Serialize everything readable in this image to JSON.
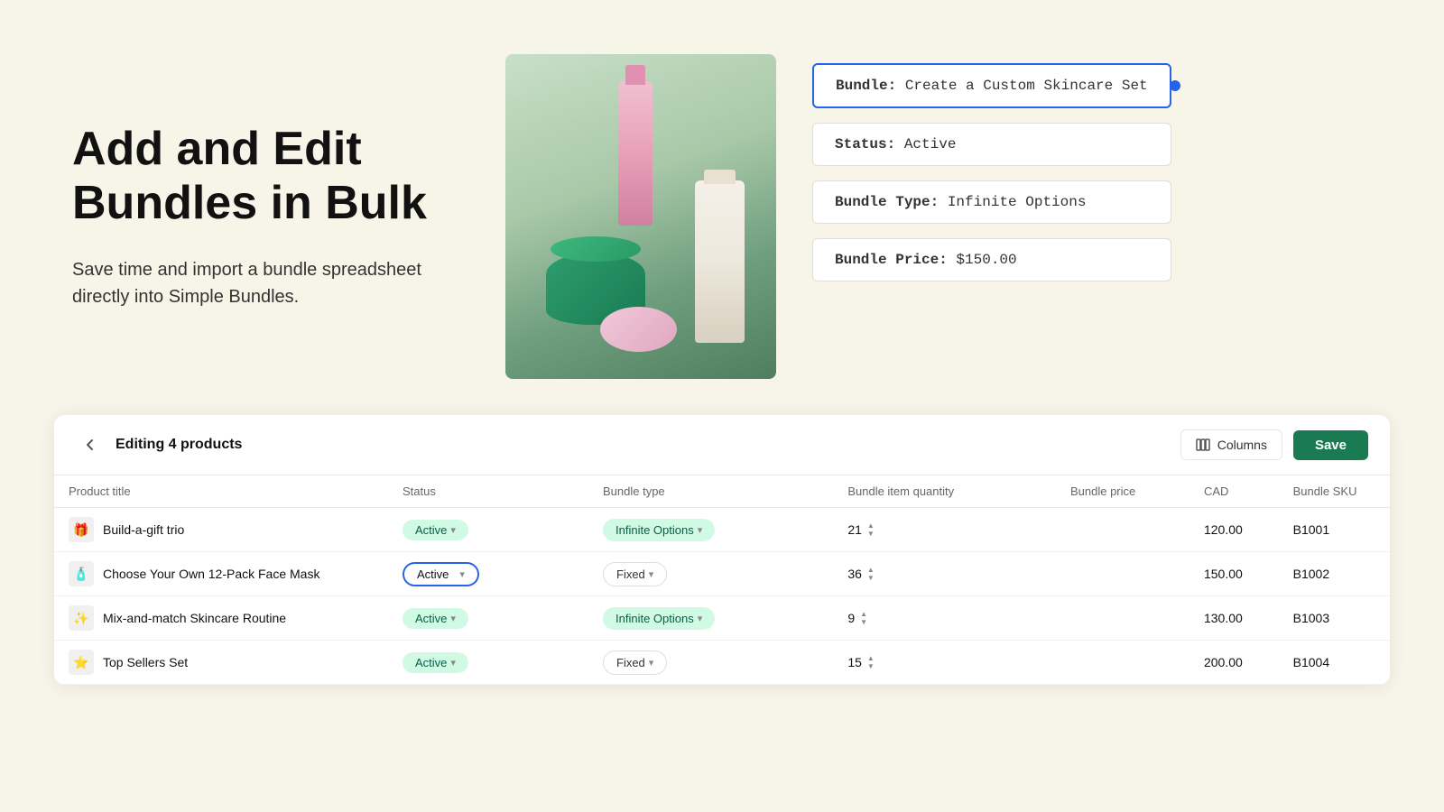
{
  "hero": {
    "title": "Add and Edit Bundles in Bulk",
    "subtitle": "Save time and import a bundle spreadsheet directly into Simple Bundles.",
    "info_cards": [
      {
        "id": "name-card",
        "label": "Bundle:",
        "value": "Create a Custom Skincare Set",
        "highlighted": true
      },
      {
        "id": "status-card",
        "label": "Status:",
        "value": "Active",
        "highlighted": false
      },
      {
        "id": "type-card",
        "label": "Bundle Type:",
        "value": "Infinite Options",
        "highlighted": false
      },
      {
        "id": "price-card",
        "label": "Bundle Price:",
        "value": "$150.00",
        "highlighted": false
      }
    ]
  },
  "table": {
    "header": {
      "back_icon": "←",
      "editing_label": "Editing 4 products",
      "columns_label": "Columns",
      "save_label": "Save"
    },
    "columns": [
      {
        "key": "title",
        "label": "Product title"
      },
      {
        "key": "status",
        "label": "Status"
      },
      {
        "key": "bundle_type",
        "label": "Bundle type"
      },
      {
        "key": "quantity",
        "label": "Bundle item quantity"
      },
      {
        "key": "price",
        "label": "Bundle price"
      },
      {
        "key": "cad",
        "label": "CAD"
      },
      {
        "key": "sku",
        "label": "Bundle SKU"
      }
    ],
    "rows": [
      {
        "id": "row-1",
        "icon": "🎁",
        "title": "Build-a-gift trio",
        "status": "Active",
        "status_active": true,
        "status_selected": false,
        "bundle_type": "Infinite Options",
        "bundle_type_infinite": true,
        "quantity": 21,
        "price": "120.00",
        "sku": "B1001"
      },
      {
        "id": "row-2",
        "icon": "🧴",
        "title": "Choose Your Own 12-Pack Face Mask",
        "status": "Active",
        "status_active": true,
        "status_selected": true,
        "bundle_type": "Fixed",
        "bundle_type_infinite": false,
        "quantity": 36,
        "price": "150.00",
        "sku": "B1002"
      },
      {
        "id": "row-3",
        "icon": "✨",
        "title": "Mix-and-match Skincare Routine",
        "status": "Active",
        "status_active": true,
        "status_selected": false,
        "bundle_type": "Infinite Options",
        "bundle_type_infinite": true,
        "quantity": 9,
        "price": "130.00",
        "sku": "B1003"
      },
      {
        "id": "row-4",
        "icon": "⭐",
        "title": "Top Sellers Set",
        "status": "Active",
        "status_active": true,
        "status_selected": false,
        "bundle_type": "Fixed",
        "bundle_type_infinite": false,
        "quantity": 15,
        "price": "200.00",
        "sku": "B1004"
      }
    ]
  }
}
